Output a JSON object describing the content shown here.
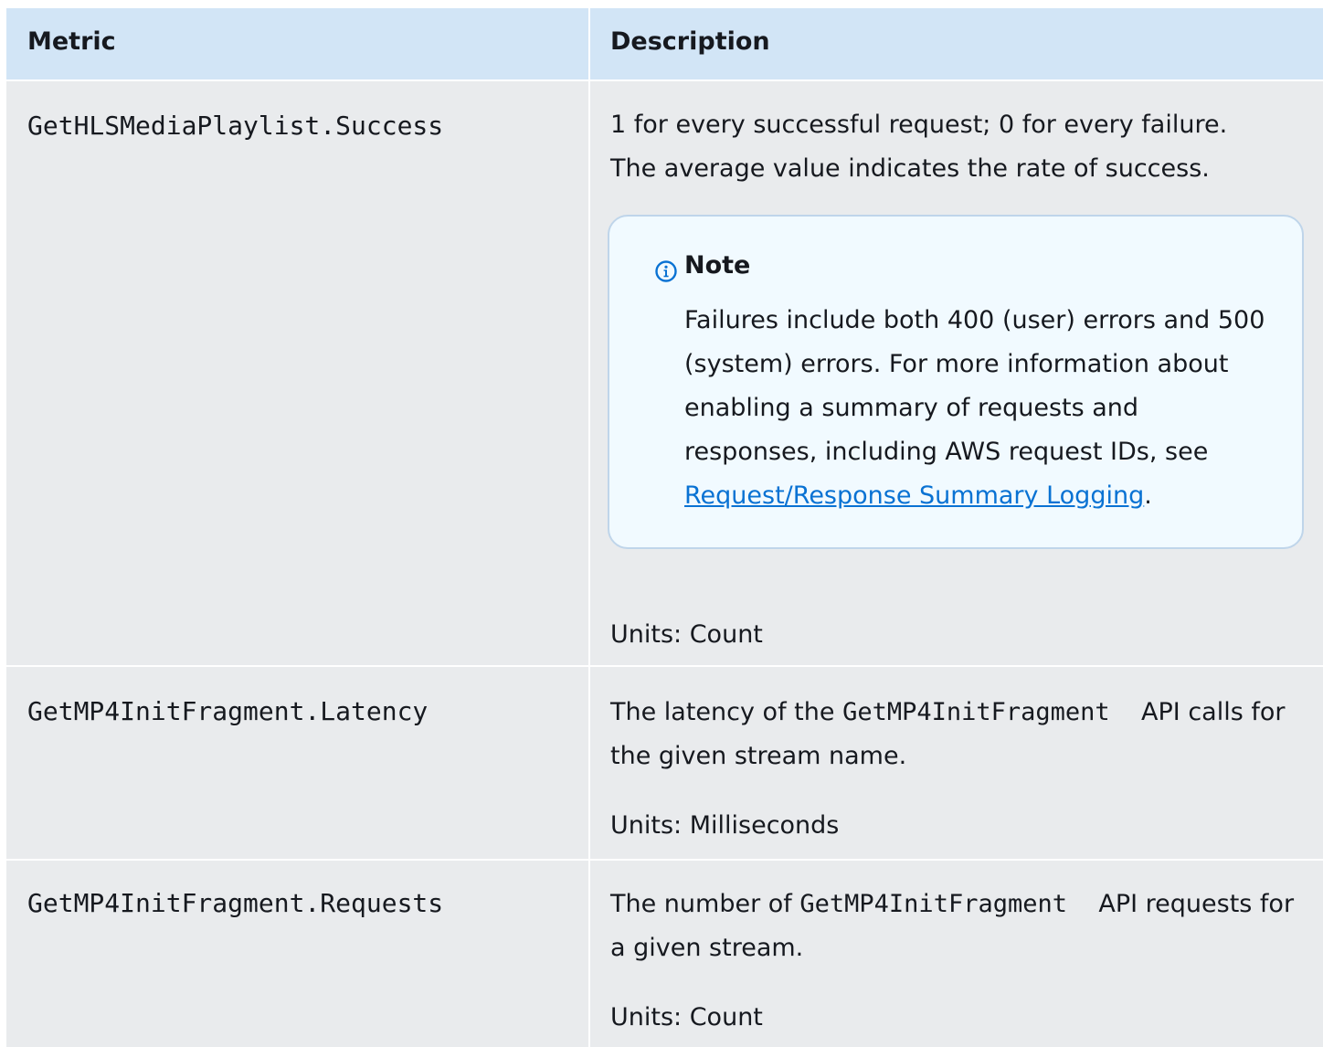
{
  "table": {
    "headers": {
      "metric": "Metric",
      "description": "Description"
    },
    "rows": [
      {
        "metric": "GetHLSMediaPlaylist.Success",
        "description_line1": "1 for every successful request; 0 for every failure.",
        "description_line2": "The average value indicates the rate of success.",
        "note": {
          "title": "Note",
          "body_text": "Failures include both 400 (user) errors and 500 (system) errors. For more information about enabling a summary of requests and responses, including AWS request IDs, see",
          "link_text": "Request/Response Summary Logging",
          "body_end": "."
        },
        "units": "Units: Count"
      },
      {
        "metric": "GetMP4InitFragment.Latency",
        "description_pre": "The latency of the",
        "description_code": "GetMP4InitFragment",
        "description_post": "API calls for the given stream name.",
        "units": "Units: Milliseconds"
      },
      {
        "metric": "GetMP4InitFragment.Requests",
        "description_pre": "The number of",
        "description_code": "GetMP4InitFragment",
        "description_post": "API requests for a given stream.",
        "units": "Units: Count"
      }
    ]
  },
  "colors": {
    "header_bg": "#d2e5f6",
    "row_bg": "#e9ebed",
    "note_bg": "#f1faff",
    "note_border": "#bfd5ea",
    "info_icon": "#0972d3",
    "link": "#0972d3"
  },
  "icons": {
    "note": "info-circle-icon"
  }
}
